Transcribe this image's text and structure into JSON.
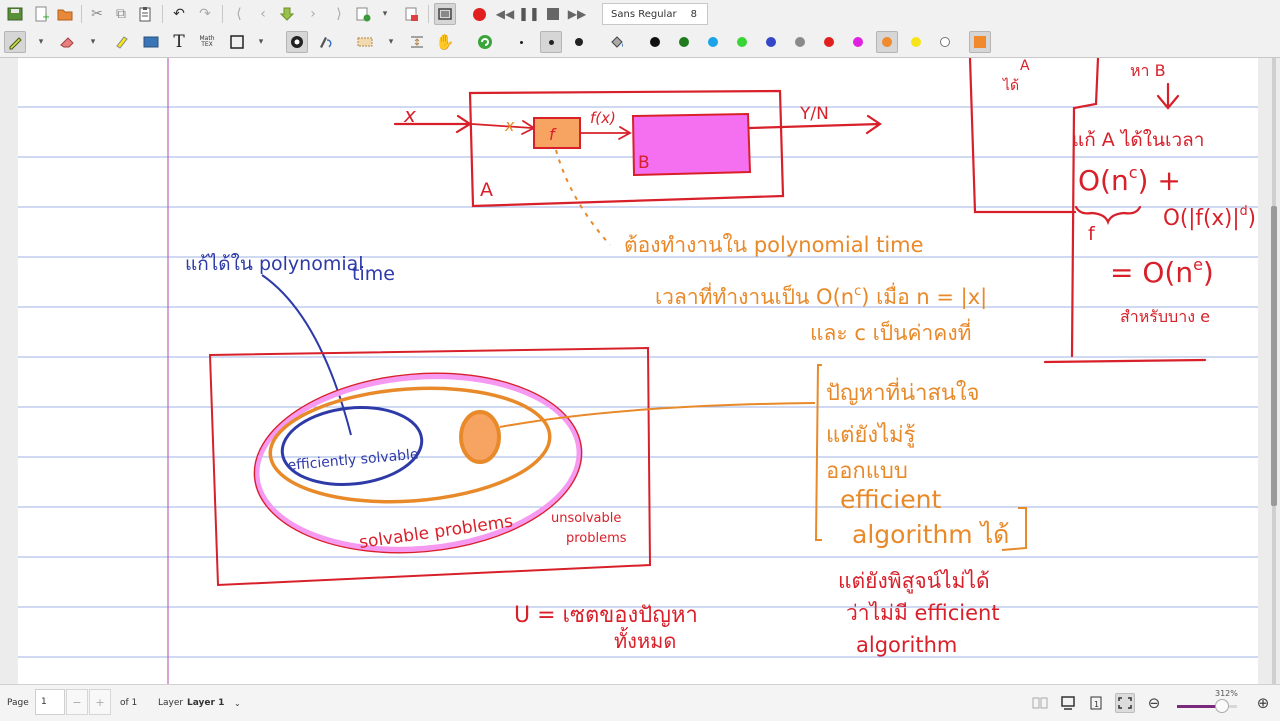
{
  "toolbar": {
    "font_name": "Sans Regular",
    "font_size": "8",
    "colors": [
      "#111111",
      "#1e7b1e",
      "#1aa3e8",
      "#39d436",
      "#3347c8",
      "#8a8a8a",
      "#e0201f",
      "#e020e0",
      "#f08a2c",
      "#f5e51a",
      "#ffffff"
    ],
    "selected_color": "#f08a2c",
    "custom_color": "#f08a2c"
  },
  "statusbar": {
    "page_label": "Page",
    "page_value": "1",
    "page_of": "of 1",
    "layer_label": "Layer",
    "layer_value": "Layer 1",
    "zoom": "312%"
  },
  "note": {
    "left_diagram": {
      "input_x": "x",
      "inner_x": "x",
      "f_box": "f",
      "f_of_x": "f(x)",
      "box_b": "B",
      "box_a": "A",
      "output": "Y/N"
    },
    "orange_note": {
      "line1": "ต้องทำงานใน polynomial time",
      "line2": "เวลาที่ทำงานเป็น O(n",
      "line2_sup": "c",
      "line2_tail": ") เมื่อ n = |x|",
      "line3": "และ c เป็นค่าคงที่"
    },
    "right_box": {
      "a_label": "A",
      "a_sub": "ได้",
      "b_label": "หา B",
      "solve_line": "แก้ A ได้ในเวลา",
      "o_nc": "O(n",
      "o_nc_sup": "c",
      "o_nc_tail": ") +",
      "f_label": "f",
      "o_fx": "O(|f(x)|",
      "o_fx_sup": "d",
      "o_fx_tail": ")",
      "equals": "= O(n",
      "equals_sup": "e",
      "equals_tail": ")",
      "for_e": "สำหรับบาง e"
    },
    "blue_note": {
      "line1": "แก้ได้ใน polynomial",
      "line2": "time"
    },
    "venn": {
      "inner": "efficiently solvable",
      "middle": "solvable problems",
      "outer": "unsolvable problems"
    },
    "orange_bracket": {
      "line1": "ปัญหาที่น่าสนใจ",
      "line2": "แต่ยังไม่รู้",
      "line3": "ออกแบบ",
      "line4": "efficient",
      "line5": "algorithm ได้"
    },
    "red_bottom_right": {
      "line1": "แต่ยังพิสูจน์ไม่ได้",
      "line2": "ว่าไม่มี efficient",
      "line3": "algorithm"
    },
    "u_note": {
      "line1": "U = เซตของปัญหา",
      "line2": "ทั้งหมด"
    }
  }
}
